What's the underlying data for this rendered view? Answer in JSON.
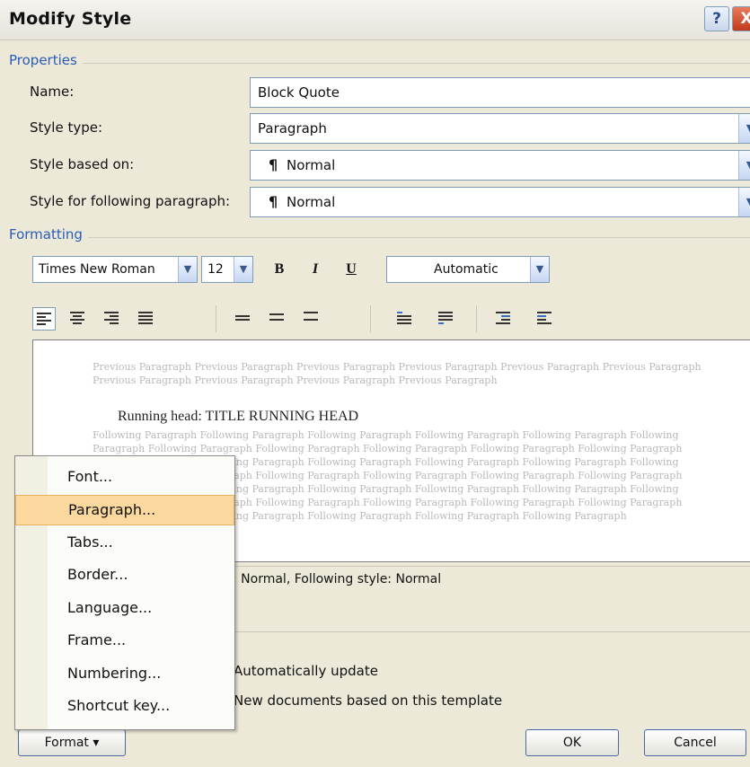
{
  "window": {
    "title": "Modify Style",
    "help_icon": "?",
    "close_icon": "X"
  },
  "properties": {
    "group_label": "Properties",
    "name_label": "Name:",
    "name_value": "Block Quote",
    "style_type_label": "Style type:",
    "style_type_value": "Paragraph",
    "based_on_label": "Style based on:",
    "based_on_value": "Normal",
    "following_label": "Style for following paragraph:",
    "following_value": "Normal",
    "pilcrow": "¶"
  },
  "formatting": {
    "group_label": "Formatting",
    "font_name": "Times New Roman",
    "font_size": "12",
    "bold": "B",
    "italic": "I",
    "underline": "U",
    "color": "Automatic"
  },
  "preview": {
    "previous_text": "Previous Paragraph Previous Paragraph Previous Paragraph Previous Paragraph Previous Paragraph Previous Paragraph Previous Paragraph Previous Paragraph Previous Paragraph Previous Paragraph",
    "heading": "Running head: TITLE RUNNING HEAD",
    "following_text": "Following Paragraph Following Paragraph Following Paragraph Following Paragraph Following Paragraph Following Paragraph Following Paragraph Following Paragraph Following Paragraph Following Paragraph Following Paragraph Following Paragraph Following Paragraph Following Paragraph Following Paragraph Following Paragraph Following Paragraph Following Paragraph Following Paragraph Following Paragraph Following Paragraph Following Paragraph Following Paragraph Following Paragraph Following Paragraph Following Paragraph Following Paragraph Following Paragraph Following Paragraph Following Paragraph Following Paragraph Following Paragraph Following Paragraph Following Paragraph Following Paragraph Following Paragraph Following Paragraph Following Paragraph"
  },
  "description": {
    "text": ": Normal, Following style: Normal"
  },
  "options": {
    "auto_update": "Automatically update",
    "new_docs": "New documents based on this template"
  },
  "menu": {
    "items": [
      "Font...",
      "Paragraph...",
      "Tabs...",
      "Border...",
      "Language...",
      "Frame...",
      "Numbering...",
      "Shortcut key..."
    ],
    "highlighted": "Paragraph..."
  },
  "buttons": {
    "format": "Format",
    "format_arrow": "▾",
    "ok": "OK",
    "cancel": "Cancel"
  },
  "colors": {
    "accent": "#2a5cb8",
    "menu_highlight": "#fbd99e",
    "dialog_bg": "#ece9d8"
  }
}
